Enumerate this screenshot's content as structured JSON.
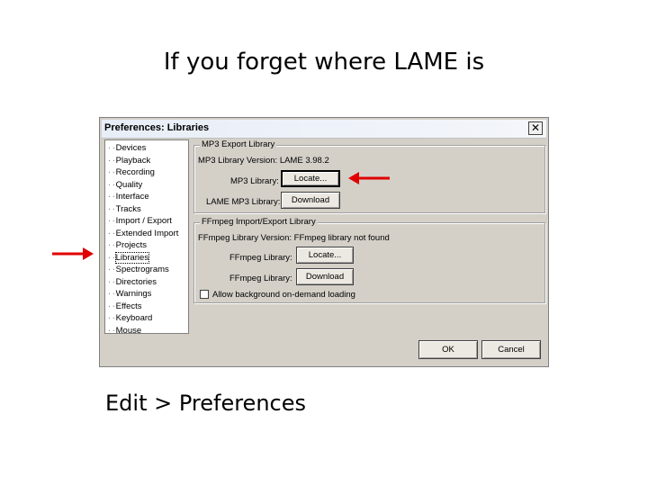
{
  "slide": {
    "title": "If you forget where LAME is",
    "caption": "Edit > Preferences"
  },
  "dialog": {
    "title": "Preferences: Libraries",
    "close_glyph": "✕",
    "tree": [
      {
        "label": "Devices",
        "selected": false
      },
      {
        "label": "Playback",
        "selected": false
      },
      {
        "label": "Recording",
        "selected": false
      },
      {
        "label": "Quality",
        "selected": false
      },
      {
        "label": "Interface",
        "selected": false
      },
      {
        "label": "Tracks",
        "selected": false
      },
      {
        "label": "Import / Export",
        "selected": false
      },
      {
        "label": "Extended Import",
        "selected": false
      },
      {
        "label": "Projects",
        "selected": false
      },
      {
        "label": "Libraries",
        "selected": true
      },
      {
        "label": "Spectrograms",
        "selected": false
      },
      {
        "label": "Directories",
        "selected": false
      },
      {
        "label": "Warnings",
        "selected": false
      },
      {
        "label": "Effects",
        "selected": false
      },
      {
        "label": "Keyboard",
        "selected": false
      },
      {
        "label": "Mouse",
        "selected": false
      }
    ],
    "mp3": {
      "legend": "MP3 Export Library",
      "version_text": "MP3 Library Version: LAME 3.98.2",
      "library_label": "MP3 Library:",
      "locate_button": "Locate...",
      "lame_label": "LAME MP3 Library:",
      "download_button": "Download"
    },
    "ffmpeg": {
      "legend": "FFmpeg Import/Export Library",
      "version_text": "FFmpeg Library Version: FFmpeg library not found",
      "library_label": "FFmpeg Library:",
      "locate_button": "Locate...",
      "library_label_2": "FFmpeg Library:",
      "download_button": "Download",
      "checkbox_label": "Allow background on-demand loading",
      "checkbox_checked": false
    },
    "ok_button": "OK",
    "cancel_button": "Cancel"
  },
  "colors": {
    "arrow": "#e00000",
    "dialog_face": "#d4d0c8"
  },
  "icons": {
    "close": "close-icon",
    "arrow_left": "red-arrow-left-icon",
    "arrow_right": "red-arrow-right-icon"
  }
}
